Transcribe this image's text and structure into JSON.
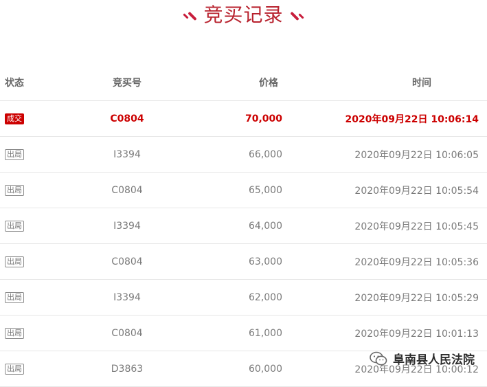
{
  "page": {
    "title": "竞买记录"
  },
  "table": {
    "headers": {
      "status": "状态",
      "bid_no": "竞买号",
      "price": "价格",
      "time": "时间"
    },
    "rows": [
      {
        "status": "成交",
        "bid_no": "C0804",
        "price": "70,000",
        "time": "2020年09月22日 10:06:14",
        "winner": true
      },
      {
        "status": "出局",
        "bid_no": "I3394",
        "price": "66,000",
        "time": "2020年09月22日 10:06:05",
        "winner": false
      },
      {
        "status": "出局",
        "bid_no": "C0804",
        "price": "65,000",
        "time": "2020年09月22日 10:05:54",
        "winner": false
      },
      {
        "status": "出局",
        "bid_no": "I3394",
        "price": "64,000",
        "time": "2020年09月22日 10:05:45",
        "winner": false
      },
      {
        "status": "出局",
        "bid_no": "C0804",
        "price": "63,000",
        "time": "2020年09月22日 10:05:36",
        "winner": false
      },
      {
        "status": "出局",
        "bid_no": "I3394",
        "price": "62,000",
        "time": "2020年09月22日 10:05:29",
        "winner": false
      },
      {
        "status": "出局",
        "bid_no": "C0804",
        "price": "61,000",
        "time": "2020年09月22日 10:01:13",
        "winner": false
      },
      {
        "status": "出局",
        "bid_no": "D3863",
        "price": "60,000",
        "time": "2020年09月22日 10:00:12",
        "winner": false
      }
    ]
  },
  "watermark": {
    "text": "阜南县人民法院",
    "icon": "wechat-icon"
  },
  "colors": {
    "accent": "#b8222e",
    "winner": "#cc0000",
    "border": "#e6e6e6"
  }
}
